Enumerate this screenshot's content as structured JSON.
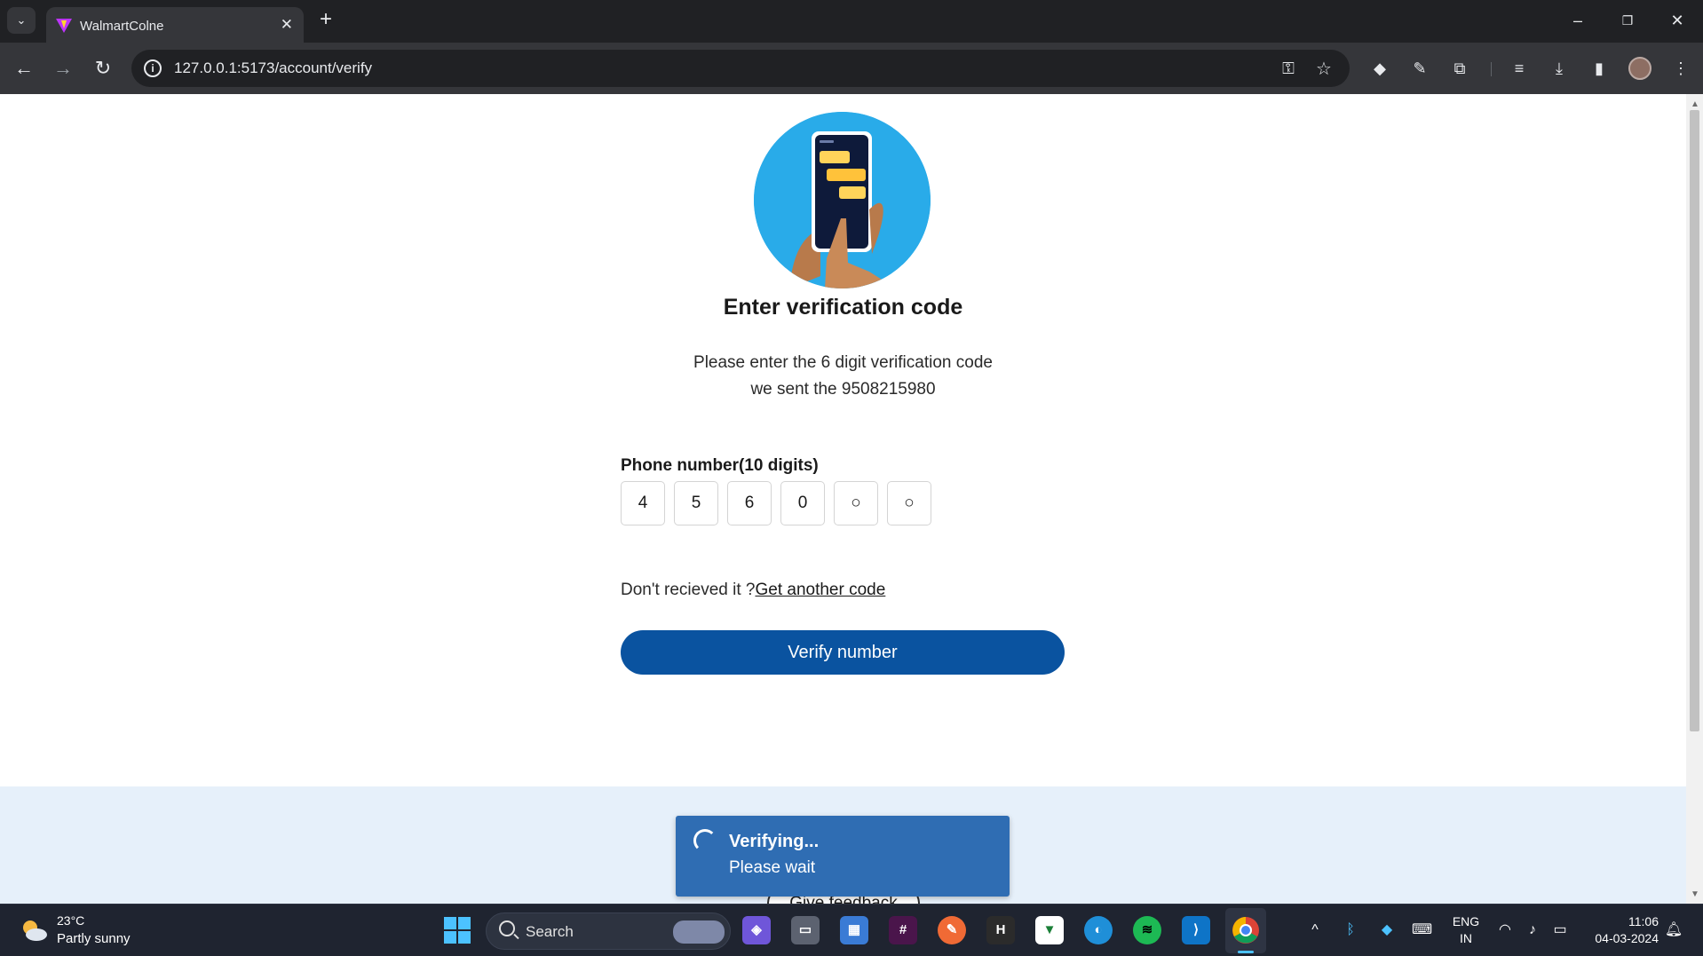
{
  "browser": {
    "tab_title": "WalmartColne",
    "url": "127.0.0.1:5173/account/verify"
  },
  "page": {
    "heading": "Enter verification code",
    "description_line1": "Please enter the 6 digit verification code",
    "description_line2": "we sent the 9508215980",
    "code_label": "Phone number(10 digits)",
    "code_digits": [
      "4",
      "5",
      "6",
      "0",
      "○",
      "○"
    ],
    "resend_prefix": "Don't recieved it ?",
    "resend_link": "Get another code",
    "verify_button": "Verify number",
    "feedback_button": "Give feedback"
  },
  "toast": {
    "title": "Verifying...",
    "message": "Please wait"
  },
  "taskbar": {
    "weather_temp": "23°C",
    "weather_desc": "Partly sunny",
    "search_label": "Search",
    "lang_line1": "ENG",
    "lang_line2": "IN",
    "time": "11:06",
    "date": "04-03-2024"
  },
  "colors": {
    "accent": "#0a53a0",
    "toast": "#2f6db3",
    "hero_circle": "#29abe9",
    "footer_bg": "#e6f0fa"
  }
}
